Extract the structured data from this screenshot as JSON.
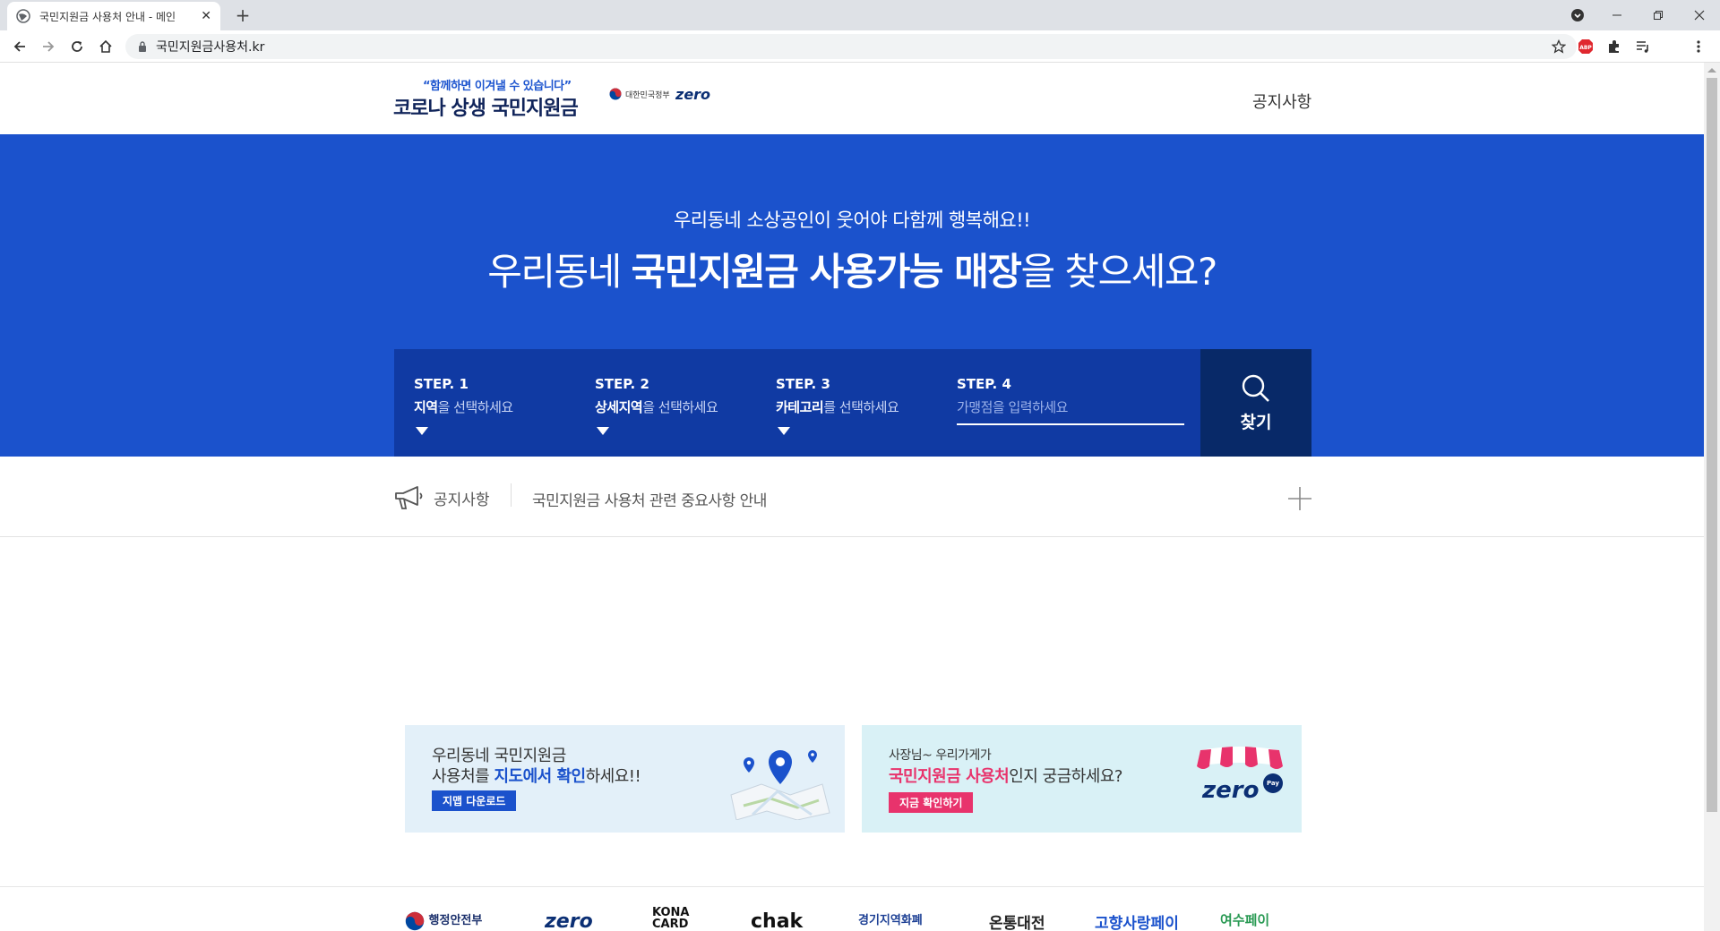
{
  "browser": {
    "tab_title": "국민지원금 사용처 안내 - 메인",
    "tab_close": "✕",
    "new_tab": "+",
    "url": "국민지원금사용처.kr",
    "ext_abp": "ABP"
  },
  "header": {
    "slogan": "“함께하면 이겨낼 수 있습니다”",
    "logo_title": "코로나 상생 국민지원금",
    "gov_label": "대한민국정부",
    "zero_label": "zero",
    "notice_link": "공지사항"
  },
  "hero": {
    "subtitle": "우리동네 소상공인이 웃어야 다함께 행복해요!!",
    "title_prefix": "우리동네 ",
    "title_bold": "국민지원금 사용가능 매장",
    "title_suffix": "을 찾으세요?"
  },
  "steps": [
    {
      "label": "STEP. 1",
      "bold": "지역",
      "rest": "을 선택하세요"
    },
    {
      "label": "STEP. 2",
      "bold": "상세지역",
      "rest": "을 선택하세요"
    },
    {
      "label": "STEP. 3",
      "bold": "카테고리",
      "rest": "를 선택하세요"
    },
    {
      "label": "STEP. 4",
      "placeholder": "가맹점을 입력하세요"
    }
  ],
  "search_button": "찾기",
  "notice": {
    "label": "공지사항",
    "text": "국민지원금 사용처 관련 중요사항 안내"
  },
  "banners": {
    "left": {
      "line1": "우리동네 국민지원금",
      "line2_prefix": "사용처를 ",
      "line2_bold": "지도에서 확인",
      "line2_suffix": "하세요!!",
      "button": "지맵 다운로드"
    },
    "right": {
      "line1": "사장님~ 우리가게가",
      "line2_bold": "국민지원금 사용처",
      "line2_suffix": "인지 궁금하세요?",
      "button": "지금 확인하기",
      "logo": "zero",
      "logo_badge": "Pay"
    }
  },
  "partners": [
    {
      "name": "행정안전부",
      "color": "#1a2f6b"
    },
    {
      "name": "zero",
      "color": "#0b2f74"
    },
    {
      "name": "KONA CARD",
      "color": "#111111"
    },
    {
      "name": "chak",
      "color": "#111111"
    },
    {
      "name": "경기지역화폐",
      "color": "#1c3f94"
    },
    {
      "name": "온통대전",
      "color": "#222222"
    },
    {
      "name": "고향사랑페이",
      "color": "#1b52cc"
    },
    {
      "name": "여수페이",
      "color": "#2a9a54"
    }
  ],
  "colors": {
    "hero_blue": "#1b52cc",
    "step_panel": "#103aa3",
    "search_button": "#082968",
    "accent_pink": "#e8336c"
  }
}
